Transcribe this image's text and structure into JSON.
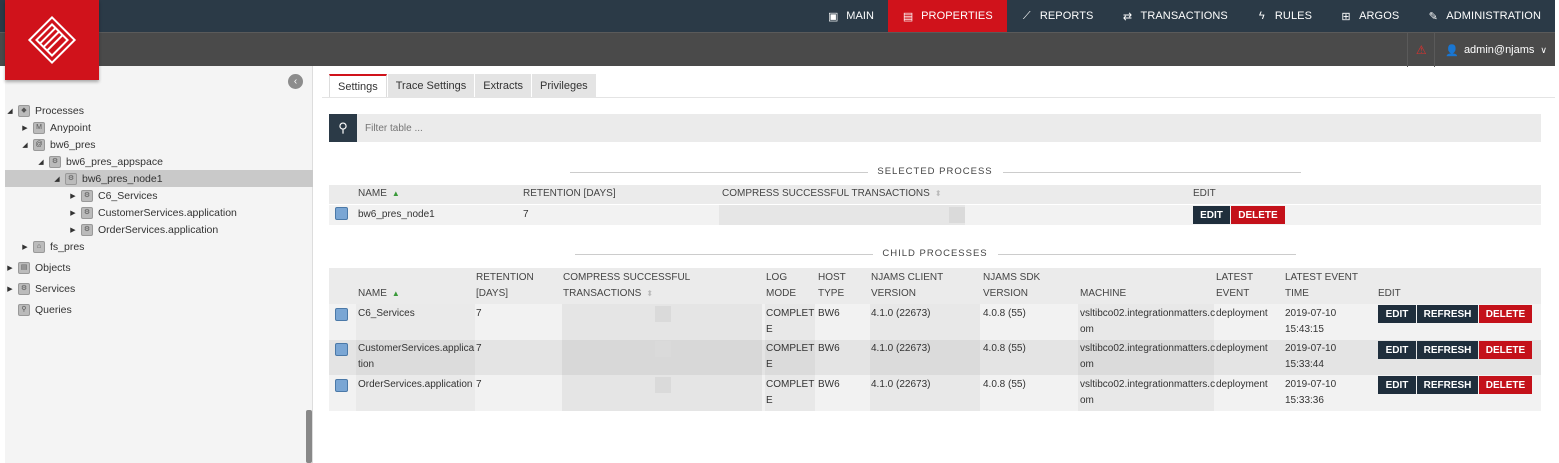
{
  "nav": {
    "items": [
      {
        "label": "MAIN",
        "icon": "main-icon",
        "glyph": "▣"
      },
      {
        "label": "PROPERTIES",
        "icon": "properties-icon",
        "glyph": "▤",
        "active": true
      },
      {
        "label": "REPORTS",
        "icon": "reports-icon",
        "glyph": "📈"
      },
      {
        "label": "TRANSACTIONS",
        "icon": "transactions-icon",
        "glyph": "⇄"
      },
      {
        "label": "RULES",
        "icon": "rules-icon",
        "glyph": "⚡"
      },
      {
        "label": "ARGOS",
        "icon": "argos-icon",
        "glyph": "⊞"
      },
      {
        "label": "ADMINISTRATION",
        "icon": "administration-icon",
        "glyph": "🔧"
      }
    ]
  },
  "user": {
    "name": "admin@njams"
  },
  "tree": {
    "processes": "Processes",
    "anypoint": "Anypoint",
    "bw6_pres": "bw6_pres",
    "appspace": "bw6_pres_appspace",
    "node1": "bw6_pres_node1",
    "c6": "C6_Services",
    "customer": "CustomerServices.application",
    "order": "OrderServices.application",
    "fs_pres": "fs_pres",
    "objects": "Objects",
    "services": "Services",
    "queries": "Queries"
  },
  "tabs": [
    "Settings",
    "Trace Settings",
    "Extracts",
    "Privileges"
  ],
  "filter": {
    "placeholder": "Filter table ..."
  },
  "selected": {
    "title": "SELECTED PROCESS",
    "headers": {
      "name": "NAME",
      "retention": "RETENTION [DAYS]",
      "compress": "COMPRESS SUCCESSFUL TRANSACTIONS",
      "edit": "EDIT"
    },
    "row": {
      "name": "bw6_pres_node1",
      "retention": "7"
    }
  },
  "child": {
    "title": "CHILD PROCESSES",
    "headers": {
      "name": "NAME",
      "retention_1": "RETENTION",
      "retention_2": "[DAYS]",
      "compress_1": "COMPRESS SUCCESSFUL",
      "compress_2": "TRANSACTIONS",
      "log_1": "LOG",
      "log_2": "MODE",
      "host_1": "HOST",
      "host_2": "TYPE",
      "client_1": "NJAMS CLIENT",
      "client_2": "VERSION",
      "sdk_1": "NJAMS SDK",
      "sdk_2": "VERSION",
      "machine": "MACHINE",
      "latest_1": "LATEST",
      "latest_2": "EVENT",
      "time_1": "LATEST EVENT",
      "time_2": "TIME",
      "edit": "EDIT"
    },
    "rows": [
      {
        "name_1": "C6_Services",
        "name_2": "",
        "retention": "7",
        "log_1": "COMPLET",
        "log_2": "E",
        "host": "BW6",
        "client": "4.1.0 (22673)",
        "sdk": "4.0.8 (55)",
        "machine_1": "vsltibco02.integrationmatters.c",
        "machine_2": "om",
        "event": "deployment",
        "time_1": "2019-07-10",
        "time_2": "15:43:15"
      },
      {
        "name_1": "CustomerServices.applica",
        "name_2": "tion",
        "retention": "7",
        "log_1": "COMPLET",
        "log_2": "E",
        "host": "BW6",
        "client": "4.1.0 (22673)",
        "sdk": "4.0.8 (55)",
        "machine_1": "vsltibco02.integrationmatters.c",
        "machine_2": "om",
        "event": "deployment",
        "time_1": "2019-07-10",
        "time_2": "15:33:44"
      },
      {
        "name_1": "OrderServices.application",
        "name_2": "",
        "retention": "7",
        "log_1": "COMPLET",
        "log_2": "E",
        "host": "BW6",
        "client": "4.1.0 (22673)",
        "sdk": "4.0.8 (55)",
        "machine_1": "vsltibco02.integrationmatters.c",
        "machine_2": "om",
        "event": "deployment",
        "time_1": "2019-07-10",
        "time_2": "15:33:36"
      }
    ]
  },
  "buttons": {
    "edit": "EDIT",
    "refresh": "REFRESH",
    "delete": "DELETE"
  }
}
